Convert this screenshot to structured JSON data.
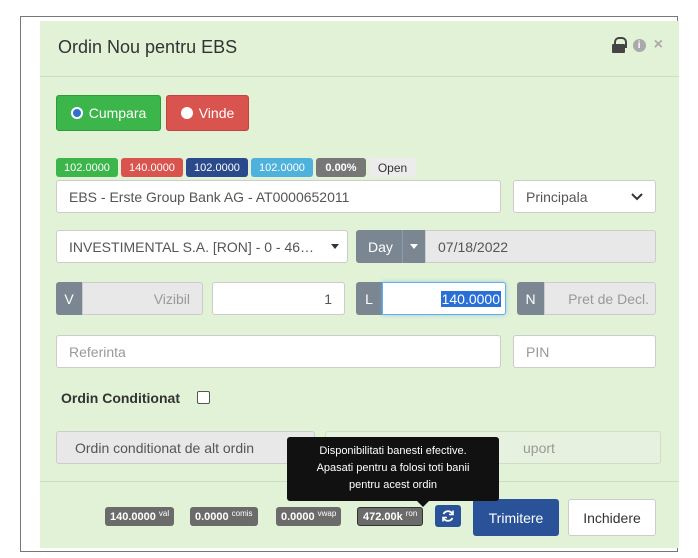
{
  "header": {
    "title": "Ordin Nou pentru EBS"
  },
  "side": {
    "buy_label": "Cumpara",
    "sell_label": "Vinde"
  },
  "badges": {
    "b1": "102.0000",
    "b2": "140.0000",
    "b3": "102.0000",
    "b4": "102.0000",
    "b5": "0.00%",
    "status": "Open"
  },
  "instrument": {
    "value": "EBS - Erste Group Bank AG - AT0000652011",
    "market": "Principala"
  },
  "account": {
    "value": "INVESTIMENTAL S.A. [RON] - 0 - 46…",
    "validity": "Day",
    "date": "07/18/2022"
  },
  "quantity": {
    "v_addon": "V",
    "visible_placeholder": "Vizibil",
    "qty": "1",
    "l_addon": "L",
    "price": "140.0000",
    "n_addon": "N",
    "trigger_placeholder": "Pret de Decl."
  },
  "reference": {
    "placeholder": "Referinta",
    "pin_placeholder": "PIN"
  },
  "conditional": {
    "label": "Ordin Conditionat",
    "select": "Ordin conditionat de alt ordin",
    "support_partial": "uport"
  },
  "tooltip": {
    "line1": "Disponibilitati banesti efective.",
    "line2": "Apasati pentru a folosi toti banii",
    "line3": "pentru acest ordin"
  },
  "footer": {
    "val": "140.0000",
    "val_sup": "val",
    "comis": "0.0000",
    "comis_sup": "comis",
    "vwap": "0.0000",
    "vwap_sup": "vwap",
    "ron": "472.00k",
    "ron_sup": "ron",
    "submit": "Trimitere",
    "close": "Inchidere"
  },
  "colors": {
    "buy": "#3cb54a",
    "sell": "#d9534f",
    "navy": "#2b4a8b",
    "cyan": "#4fb2dd",
    "gray": "#777777",
    "submit": "#2a5299",
    "modal_bg": "#e1f2d7"
  },
  "icons": [
    "lock-icon",
    "info-icon",
    "close-icon",
    "chevron-down-icon",
    "refresh-icon"
  ]
}
